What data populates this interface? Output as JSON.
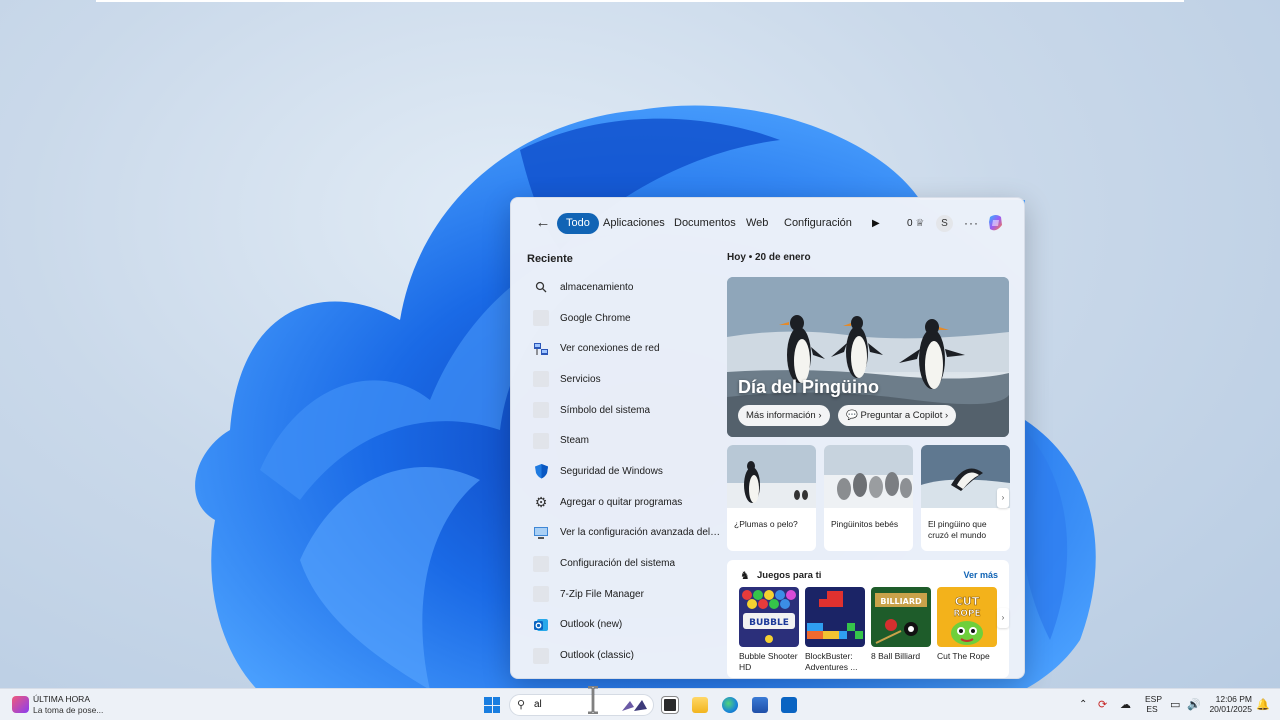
{
  "flyout": {
    "tabs": {
      "todo": "Todo",
      "aplicaciones": "Aplicaciones",
      "documentos": "Documentos",
      "web": "Web",
      "configuracion": "Configuración"
    },
    "points": "0",
    "avatar_letter": "S",
    "recent_title": "Reciente",
    "recent": [
      {
        "label": "almacenamiento",
        "icon": "search-icon"
      },
      {
        "label": "Google Chrome",
        "icon": "app-icon"
      },
      {
        "label": "Ver conexiones de red",
        "icon": "network-icon"
      },
      {
        "label": "Servicios",
        "icon": "app-icon"
      },
      {
        "label": "Símbolo del sistema",
        "icon": "app-icon"
      },
      {
        "label": "Steam",
        "icon": "app-icon"
      },
      {
        "label": "Seguridad de Windows",
        "icon": "shield-icon"
      },
      {
        "label": "Agregar o quitar programas",
        "icon": "gear-icon"
      },
      {
        "label": "Ver la configuración avanzada del sist...",
        "icon": "system-icon"
      },
      {
        "label": "Configuración del sistema",
        "icon": "app-icon"
      },
      {
        "label": "7-Zip File Manager",
        "icon": "app-icon"
      },
      {
        "label": "Outlook (new)",
        "icon": "outlook-icon"
      },
      {
        "label": "Outlook (classic)",
        "icon": "app-icon"
      }
    ],
    "today": "Hoy",
    "date": "20 de enero",
    "hero": {
      "title": "Día del Pingüino",
      "more_info": "Más información",
      "ask_copilot": "Preguntar a Copilot"
    },
    "cards": [
      {
        "caption": "¿Plumas o pelo?"
      },
      {
        "caption": "Pingüinitos bebés"
      },
      {
        "caption": "El pingüino que cruzó el mundo"
      }
    ],
    "games": {
      "title": "Juegos para ti",
      "see_more": "Ver más",
      "items": [
        {
          "name": "Bubble Shooter HD"
        },
        {
          "name": "BlockBuster: Adventures ..."
        },
        {
          "name": "8 Ball Billiard"
        },
        {
          "name": "Cut The Rope"
        }
      ]
    }
  },
  "taskbar": {
    "news_title": "ÚLTIMA HORA",
    "news_sub": "La toma de pose...",
    "search_text": "al",
    "lang_top": "ESP",
    "lang_bottom": "ES",
    "time": "12:06 PM",
    "date": "20/01/2025"
  },
  "colors": {
    "accent": "#1164b5",
    "wallpaper_bloom": "#1a74e8"
  }
}
